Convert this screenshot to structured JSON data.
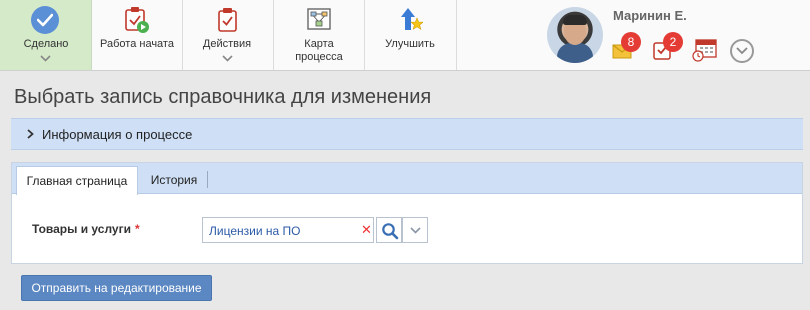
{
  "toolbar": {
    "done_label": "Сделано",
    "work_started_label": "Работа начата",
    "actions_label": "Действия",
    "process_map_label_line1": "Карта",
    "process_map_label_line2": "процесса",
    "improve_label": "Улучшить"
  },
  "user": {
    "name": "Маринин Е.",
    "mail_count": "8",
    "tasks_count": "2"
  },
  "page": {
    "title": "Выбрать запись справочника для изменения",
    "process_info_label": "Информация о процессе"
  },
  "tabs": [
    {
      "label": "Главная страница",
      "active": true
    },
    {
      "label": "История",
      "active": false
    }
  ],
  "form": {
    "field_label": "Товары и услуги",
    "required_mark": "*",
    "field_value": "Лицензии на ПО",
    "clear_glyph": "✕"
  },
  "submit_label": "Отправить на редактирование",
  "colors": {
    "done_bg": "#d5eac9",
    "accent_blue": "#5b87c2",
    "badge_red": "#e43b35",
    "panel_blue": "#cfe0f6"
  }
}
